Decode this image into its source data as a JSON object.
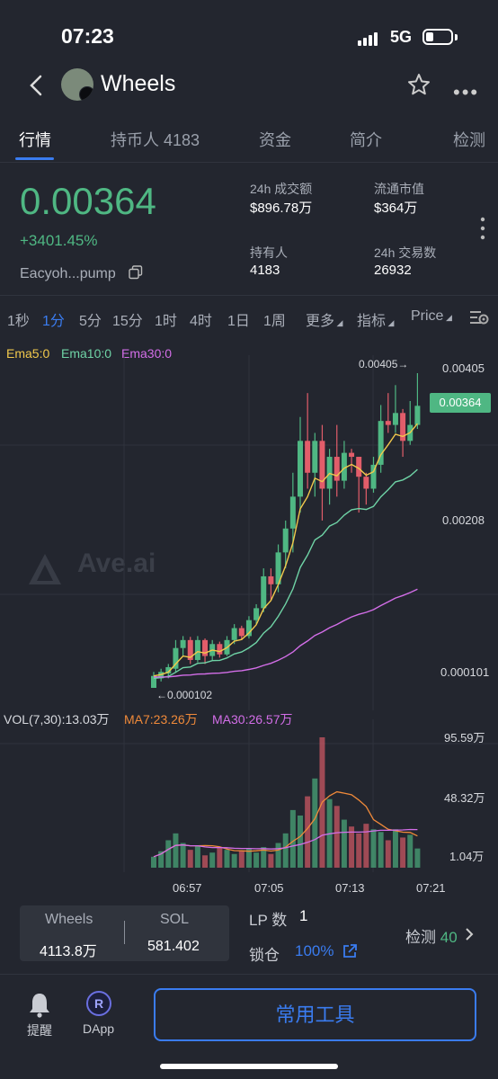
{
  "status": {
    "time": "07:23",
    "network": "5G"
  },
  "header": {
    "title": "Wheels",
    "back_icon": "back-arrow-icon",
    "star_icon": "star-icon",
    "more_icon": "more-icon"
  },
  "tabs": [
    {
      "label": "行情"
    },
    {
      "label": "持币人 4183"
    },
    {
      "label": "资金"
    },
    {
      "label": "简介"
    },
    {
      "label": "检测"
    }
  ],
  "summary": {
    "price": "0.00364",
    "change": "+3401.45%",
    "address": "Eacyoh...pump",
    "stats": [
      {
        "label": "24h 成交额",
        "value": "$896.78万"
      },
      {
        "label": "流通市值",
        "value": "$364万"
      },
      {
        "label": "持有人",
        "value": "4183"
      },
      {
        "label": "24h 交易数",
        "value": "26932"
      }
    ]
  },
  "timeframes": [
    "1秒",
    "1分",
    "5分",
    "15分",
    "1时",
    "4时",
    "1日",
    "1周",
    "更多",
    "指标",
    "Price"
  ],
  "ema_legend": {
    "ema5": "Ema5:0",
    "ema10": "Ema10:0",
    "ema30": "Ema30:0"
  },
  "colors": {
    "up": "#4fb783",
    "down": "#e25d6a",
    "accent": "#3a7cf0",
    "ema5": "#f2c94c",
    "ema10": "#6fd3a6",
    "ema30": "#d36ee8",
    "ma7": "#f08a3a",
    "ma30": "#d36ee8"
  },
  "chart_data": [
    {
      "type": "candlestick",
      "price_axis_labels": [
        "0.00405",
        "0.00208",
        "0.000101"
      ],
      "current_price_label": "0.00364",
      "high_annotation": "0.00405→",
      "low_annotation": "←0.000102",
      "x_labels": [
        "06:57",
        "07:05",
        "07:13",
        "07:21"
      ],
      "candles": [
        {
          "o": 0.0001,
          "c": 0.00025,
          "h": 0.0003,
          "l": 0.0001
        },
        {
          "o": 0.00022,
          "c": 0.0003,
          "h": 0.00034,
          "l": 0.00018
        },
        {
          "o": 0.00028,
          "c": 0.00036,
          "h": 0.0004,
          "l": 0.00022
        },
        {
          "o": 0.00034,
          "c": 0.0006,
          "h": 0.0007,
          "l": 0.0003
        },
        {
          "o": 0.0006,
          "c": 0.0007,
          "h": 0.00075,
          "l": 0.0005
        },
        {
          "o": 0.0007,
          "c": 0.00045,
          "h": 0.00074,
          "l": 0.0004
        },
        {
          "o": 0.00045,
          "c": 0.0007,
          "h": 0.00075,
          "l": 0.00042
        },
        {
          "o": 0.0007,
          "c": 0.0005,
          "h": 0.00072,
          "l": 0.0004
        },
        {
          "o": 0.0005,
          "c": 0.00065,
          "h": 0.0007,
          "l": 0.00045
        },
        {
          "o": 0.00065,
          "c": 0.00052,
          "h": 0.00068,
          "l": 0.00048
        },
        {
          "o": 0.00052,
          "c": 0.0007,
          "h": 0.00075,
          "l": 0.0005
        },
        {
          "o": 0.0007,
          "c": 0.00085,
          "h": 0.0009,
          "l": 0.00065
        },
        {
          "o": 0.00085,
          "c": 0.00075,
          "h": 0.00088,
          "l": 0.0007
        },
        {
          "o": 0.00075,
          "c": 0.00095,
          "h": 0.001,
          "l": 0.00072
        },
        {
          "o": 0.00095,
          "c": 0.0011,
          "h": 0.00115,
          "l": 0.0009
        },
        {
          "o": 0.0011,
          "c": 0.0015,
          "h": 0.0016,
          "l": 0.00105
        },
        {
          "o": 0.0015,
          "c": 0.0014,
          "h": 0.0016,
          "l": 0.0012
        },
        {
          "o": 0.0014,
          "c": 0.0018,
          "h": 0.0019,
          "l": 0.0013
        },
        {
          "o": 0.0018,
          "c": 0.0021,
          "h": 0.0022,
          "l": 0.0016
        },
        {
          "o": 0.0021,
          "c": 0.0025,
          "h": 0.0028,
          "l": 0.0018
        },
        {
          "o": 0.0025,
          "c": 0.0032,
          "h": 0.0035,
          "l": 0.0023
        },
        {
          "o": 0.0032,
          "c": 0.0028,
          "h": 0.0038,
          "l": 0.0026
        },
        {
          "o": 0.0028,
          "c": 0.0032,
          "h": 0.0033,
          "l": 0.0025
        },
        {
          "o": 0.0032,
          "c": 0.0026,
          "h": 0.0034,
          "l": 0.0022
        },
        {
          "o": 0.0026,
          "c": 0.003,
          "h": 0.0031,
          "l": 0.0024
        },
        {
          "o": 0.003,
          "c": 0.0027,
          "h": 0.0034,
          "l": 0.0025
        },
        {
          "o": 0.0027,
          "c": 0.00305,
          "h": 0.0032,
          "l": 0.0026
        },
        {
          "o": 0.00305,
          "c": 0.003,
          "h": 0.0031,
          "l": 0.0028
        },
        {
          "o": 0.003,
          "c": 0.00275,
          "h": 0.003,
          "l": 0.0023
        },
        {
          "o": 0.00275,
          "c": 0.0026,
          "h": 0.0028,
          "l": 0.0024
        },
        {
          "o": 0.0026,
          "c": 0.0029,
          "h": 0.003,
          "l": 0.00255
        },
        {
          "o": 0.0029,
          "c": 0.00345,
          "h": 0.00365,
          "l": 0.0028
        },
        {
          "o": 0.00345,
          "c": 0.0034,
          "h": 0.0038,
          "l": 0.0033
        },
        {
          "o": 0.0034,
          "c": 0.00355,
          "h": 0.0039,
          "l": 0.0033
        },
        {
          "o": 0.00355,
          "c": 0.0032,
          "h": 0.0036,
          "l": 0.003
        },
        {
          "o": 0.0032,
          "c": 0.0034,
          "h": 0.0037,
          "l": 0.00315
        },
        {
          "o": 0.0034,
          "c": 0.00364,
          "h": 0.00405,
          "l": 0.00335
        }
      ]
    },
    {
      "type": "bar",
      "legend": {
        "vol": "VOL(7,30):13.03万",
        "ma7": "MA7:23.26万",
        "ma30": "MA30:26.57万"
      },
      "axis_labels": [
        "95.59万",
        "48.32万",
        "1.04万"
      ],
      "x_labels": [
        "06:57",
        "07:05",
        "07:13",
        "07:21"
      ],
      "volumes": [
        8,
        12,
        20,
        25,
        18,
        13,
        16,
        9,
        11,
        15,
        13,
        10,
        12,
        14,
        11,
        15,
        10,
        18,
        25,
        42,
        38,
        52,
        65,
        95,
        50,
        45,
        35,
        30,
        25,
        32,
        28,
        26,
        20,
        28,
        22,
        24,
        14
      ]
    }
  ],
  "bottom": {
    "pair_left_label": "Wheels",
    "pair_left_value": "4113.8万",
    "pair_right_label": "SOL",
    "pair_right_value": "581.402",
    "lp_label": "LP 数",
    "lp_value": "1",
    "lock_label": "锁仓",
    "lock_value": "100%",
    "detect_label": "检测",
    "detect_value": "40"
  },
  "nav": {
    "alert_label": "提醒",
    "dapp_label": "DApp",
    "dapp_letter": "R",
    "tools_button": "常用工具"
  },
  "watermark": "Ave.ai"
}
